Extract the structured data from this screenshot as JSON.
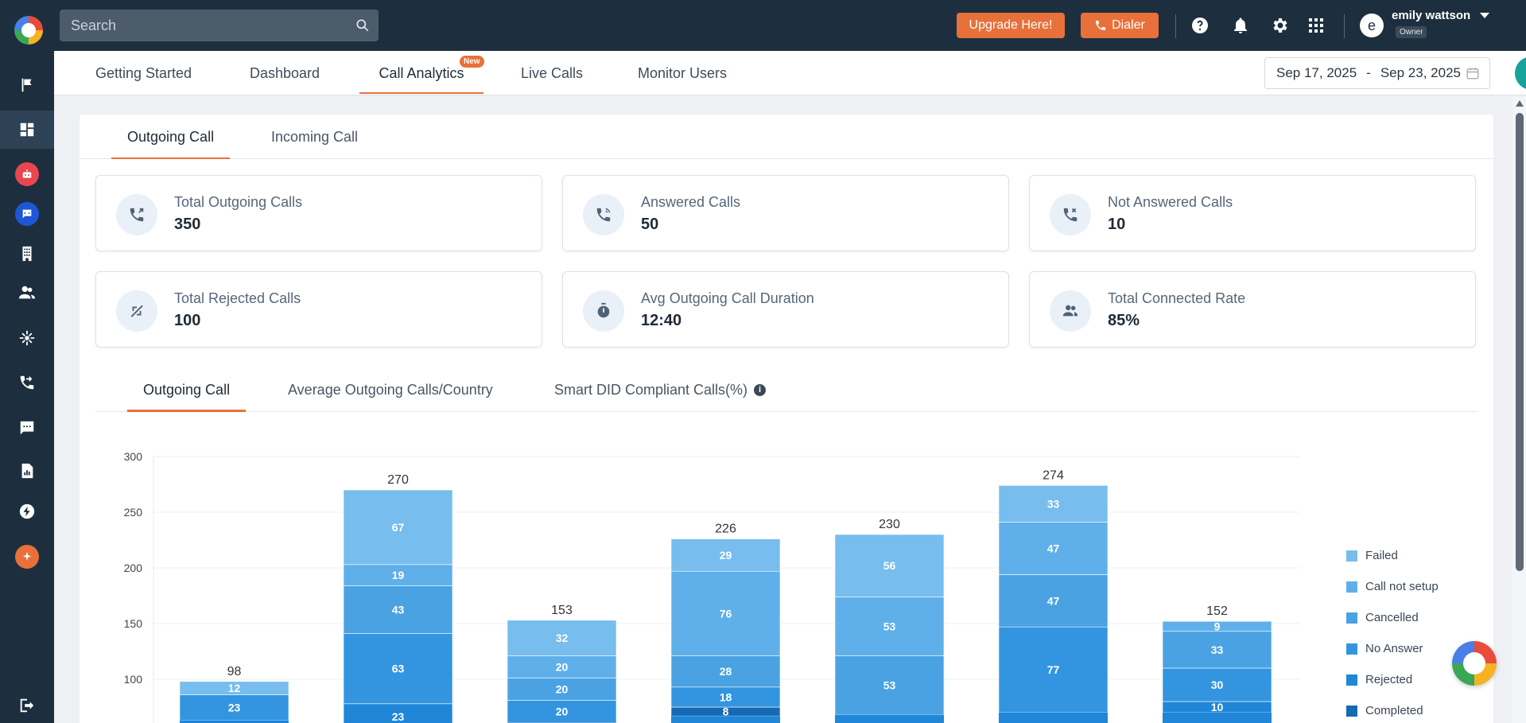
{
  "search": {
    "placeholder": "Search"
  },
  "topbar": {
    "upgrade_label": "Upgrade Here!",
    "dialer_label": "Dialer",
    "user": {
      "initial": "e",
      "name": "emily wattson",
      "role": "Owner"
    },
    "icons": [
      "help-icon",
      "bell-icon",
      "settings-icon",
      "apps-grid-icon"
    ]
  },
  "sidebar": {
    "items": [
      "flag-icon",
      "dashboard-icon",
      "bot-icon",
      "chat-bot-icon",
      "phone-building-icon",
      "users-icon",
      "integrations-icon",
      "call-flow-icon",
      "sms-icon",
      "reports-icon",
      "power-icon",
      "ai-assistant-icon",
      "logout-icon"
    ]
  },
  "nav": {
    "tabs": [
      {
        "label": "Getting Started"
      },
      {
        "label": "Dashboard"
      },
      {
        "label": "Call Analytics",
        "badge": "New"
      },
      {
        "label": "Live Calls"
      },
      {
        "label": "Monitor Users"
      }
    ],
    "active": "Call Analytics",
    "date_from": "Sep 17, 2025",
    "date_sep": "-",
    "date_to": "Sep 23, 2025"
  },
  "subtabs": [
    "Outgoing Call",
    "Incoming Call"
  ],
  "stats": [
    {
      "label": "Total Outgoing Calls",
      "value": "350"
    },
    {
      "label": "Answered Calls",
      "value": "50"
    },
    {
      "label": "Not Answered Calls",
      "value": "10"
    },
    {
      "label": "Total Rejected Calls",
      "value": "100"
    },
    {
      "label": "Avg Outgoing Call Duration",
      "value": "12:40"
    },
    {
      "label": "Total Connected Rate",
      "value": "85%"
    }
  ],
  "chart_tabs": [
    "Outgoing Call",
    "Average Outgoing Calls/Country",
    "Smart DID Compliant Calls(%)"
  ],
  "chart_data": {
    "type": "bar",
    "stacked": true,
    "ylim": [
      80,
      300
    ],
    "yticks": [
      100,
      150,
      200,
      250,
      300
    ],
    "totals": [
      98,
      270,
      153,
      226,
      230,
      274,
      152
    ],
    "series": [
      {
        "name": "Completed",
        "color": "#1769b3",
        "values": [
          null,
          null,
          null,
          8,
          null,
          null,
          null
        ]
      },
      {
        "name": "Rejected",
        "color": "#1f86d8",
        "values": [
          null,
          23,
          null,
          null,
          null,
          null,
          10
        ]
      },
      {
        "name": "No Answer",
        "color": "#3395e0",
        "values": [
          23,
          63,
          20,
          18,
          null,
          77,
          30
        ]
      },
      {
        "name": "Cancelled",
        "color": "#4aa2e3",
        "values": [
          null,
          43,
          20,
          28,
          53,
          47,
          33
        ]
      },
      {
        "name": "Call not setup",
        "color": "#5fb0ea",
        "values": [
          null,
          19,
          20,
          76,
          53,
          47,
          9
        ]
      },
      {
        "name": "Failed",
        "color": "#77bdee",
        "values": [
          12,
          67,
          32,
          29,
          56,
          33,
          null
        ]
      }
    ],
    "legend_position": "right",
    "grid": true
  }
}
